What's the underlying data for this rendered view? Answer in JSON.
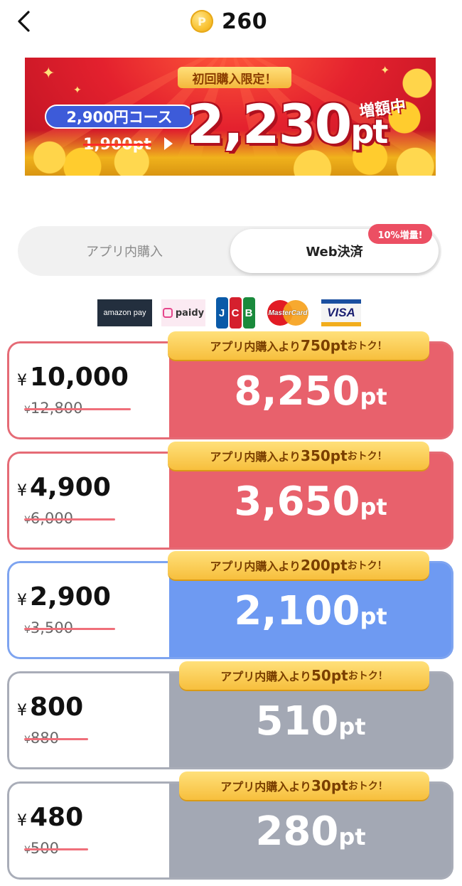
{
  "header": {
    "balance": "260",
    "coin_symbol": "P"
  },
  "banner": {
    "tag": "初回購入限定！",
    "course": "2,900円コース",
    "old_points": "1,900pt",
    "new_points_number": "2,230",
    "new_points_unit": "pt",
    "increase_label": "増額中",
    "colors": {
      "background": "#e4212e",
      "coin": "#f9c231",
      "course_pill": "#3d5bd9"
    }
  },
  "tabs": {
    "in_app": "アプリ内購入",
    "web": "Web決済",
    "web_badge": "10%増量!",
    "selected": "web"
  },
  "payment_methods": {
    "amazon": "amazon pay",
    "paidy": "paidy",
    "jcb": [
      "J",
      "C",
      "B"
    ],
    "mastercard": "MasterCard",
    "visa": "VISA"
  },
  "packs": [
    {
      "yen": "¥",
      "price": "10,000",
      "old_price": "12,800",
      "points": "8,250",
      "unit": "pt",
      "ribbon_prefix": "アプリ内購入より",
      "ribbon_amount": "750pt",
      "ribbon_suffix": "おトク！",
      "theme": "red"
    },
    {
      "yen": "¥",
      "price": "4,900",
      "old_price": "6,000",
      "points": "3,650",
      "unit": "pt",
      "ribbon_prefix": "アプリ内購入より",
      "ribbon_amount": "350pt",
      "ribbon_suffix": "おトク！",
      "theme": "red"
    },
    {
      "yen": "¥",
      "price": "2,900",
      "old_price": "3,500",
      "points": "2,100",
      "unit": "pt",
      "ribbon_prefix": "アプリ内購入より",
      "ribbon_amount": "200pt",
      "ribbon_suffix": "おトク！",
      "theme": "blue"
    },
    {
      "yen": "¥",
      "price": "800",
      "old_price": "880",
      "points": "510",
      "unit": "pt",
      "ribbon_prefix": "アプリ内購入より",
      "ribbon_amount": "50pt",
      "ribbon_suffix": "おトク！",
      "theme": "gray"
    },
    {
      "yen": "¥",
      "price": "480",
      "old_price": "500",
      "points": "280",
      "unit": "pt",
      "ribbon_prefix": "アプリ内購入より",
      "ribbon_amount": "30pt",
      "ribbon_suffix": "おトク！",
      "theme": "gray"
    }
  ],
  "colors": {
    "red": "#e8616c",
    "blue": "#6e9af2",
    "gray": "#a3a8b4",
    "red_border": "#e56b76",
    "blue_border": "#7ea4f0",
    "gray_border": "#a9adb8",
    "badge": "#ec4f63",
    "ribbon": "#f7bf3d"
  }
}
